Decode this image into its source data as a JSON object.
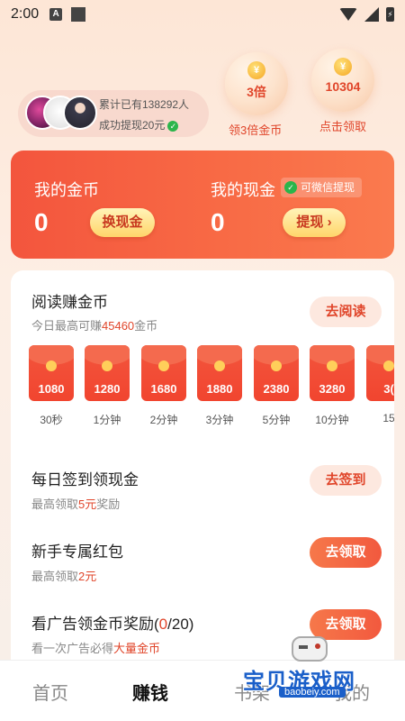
{
  "status_bar": {
    "time": "2:00",
    "notif_letter": "A"
  },
  "stats": {
    "total_line": "累计已有138292人",
    "withdraw_line": "成功提现20元"
  },
  "bubbles": [
    {
      "value": "3倍",
      "label": "领3倍金币",
      "coin_symbol": "¥"
    },
    {
      "value": "10304",
      "label": "点击领取",
      "coin_symbol": "¥"
    }
  ],
  "wallet": {
    "coins_title": "我的金币",
    "coins_value": "0",
    "exchange_label": "换现金",
    "cash_title": "我的现金",
    "wechat_tag": "可微信提现",
    "cash_value": "0",
    "withdraw_label": "提现 ›"
  },
  "read_task": {
    "title": "阅读赚金币",
    "sub_prefix": "今日最高可赚",
    "sub_amount": "45460",
    "sub_suffix": "金币",
    "button": "去阅读",
    "envelopes": [
      {
        "amount": "1080",
        "time": "30秒"
      },
      {
        "amount": "1280",
        "time": "1分钟"
      },
      {
        "amount": "1680",
        "time": "2分钟"
      },
      {
        "amount": "1880",
        "time": "3分钟"
      },
      {
        "amount": "2380",
        "time": "5分钟"
      },
      {
        "amount": "3280",
        "time": "10分钟"
      },
      {
        "amount": "3(",
        "time": "15"
      }
    ]
  },
  "signin_task": {
    "title": "每日签到领现金",
    "sub_prefix": "最高领取",
    "sub_amount": "5元",
    "sub_suffix": "奖励",
    "button": "去签到"
  },
  "newbie_task": {
    "title": "新手专属红包",
    "sub_prefix": "最高领取",
    "sub_amount": "2元",
    "button": "去领取"
  },
  "ad_task": {
    "title_prefix": "看广告领金币奖励(",
    "title_count": "0",
    "title_suffix": "/20)",
    "sub_prefix": "看一次广告必得",
    "sub_highlight": "大量金币",
    "button": "去领取"
  },
  "nav": {
    "items": [
      "首页",
      "赚钱",
      "书架",
      "我的"
    ],
    "active_index": 1
  },
  "watermark": {
    "cn": "宝贝游戏网",
    "en": "baobeiy.com"
  },
  "colors": {
    "accent": "#e0452a",
    "card_red": "#f3553d",
    "wechat_green": "#2bb54b"
  }
}
